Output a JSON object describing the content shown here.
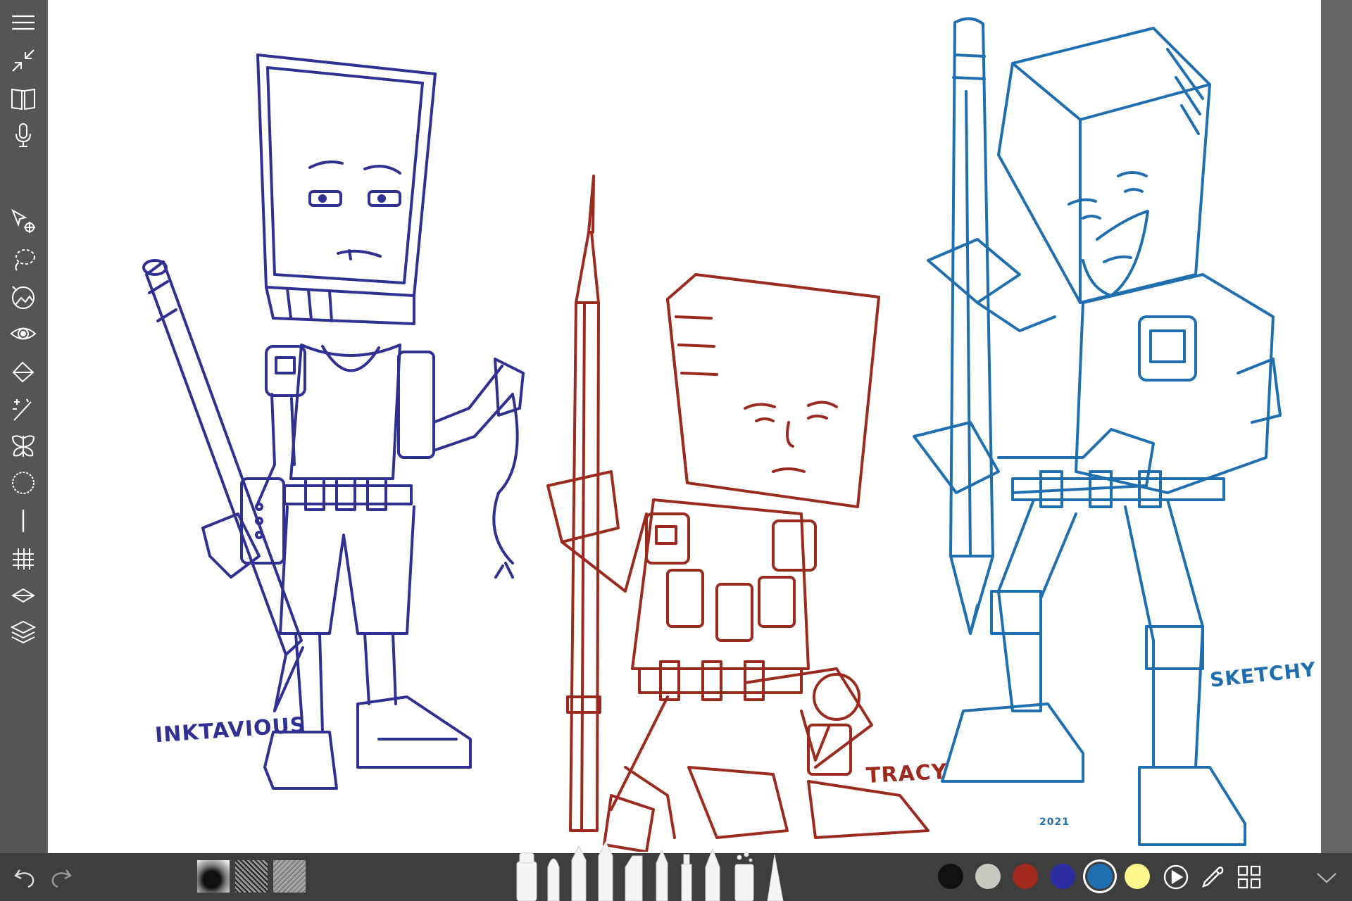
{
  "app": {
    "title": ""
  },
  "left_toolbar": {
    "items": [
      {
        "name": "menu-icon"
      },
      {
        "name": "collapse-icon"
      },
      {
        "name": "gallery-icon"
      },
      {
        "name": "microphone-icon"
      },
      {
        "name": "transform-icon"
      },
      {
        "name": "lasso-select-icon"
      },
      {
        "name": "crop-icon"
      },
      {
        "name": "view-icon"
      },
      {
        "name": "fill-icon"
      },
      {
        "name": "magic-wand-icon"
      },
      {
        "name": "symmetry-icon"
      },
      {
        "name": "ellipse-guide-icon"
      },
      {
        "name": "ruler-icon"
      },
      {
        "name": "grid-icon"
      },
      {
        "name": "perspective-icon"
      },
      {
        "name": "layers-icon"
      }
    ]
  },
  "canvas": {
    "labels": {
      "left": "INKTAVIOUS",
      "middle": "TRACY",
      "right": "SKETCHY",
      "signature_year": "2021"
    },
    "colors": {
      "left": "#2e3192",
      "middle": "#9b2a1f",
      "right": "#1f6fb0"
    }
  },
  "bottom_bar": {
    "undo": "undo-icon",
    "redo": "redo-icon",
    "textures": [
      "texture-smudge",
      "texture-noise-dark",
      "texture-noise-gray"
    ],
    "brushes": [
      "marker",
      "paint-brush",
      "pencil",
      "technical-pen",
      "highlighter",
      "crayon",
      "airbrush",
      "fountain-pen",
      "spray-can",
      "cone-brush"
    ],
    "swatches": [
      {
        "name": "black",
        "color": "#111111"
      },
      {
        "name": "light-gray",
        "color": "#c9c9c2"
      },
      {
        "name": "red",
        "color": "#a32a1e"
      },
      {
        "name": "indigo",
        "color": "#2b2da0"
      },
      {
        "name": "blue",
        "color": "#1f6fb0",
        "selected": true
      },
      {
        "name": "yellow",
        "color": "#fbf78a"
      }
    ]
  }
}
